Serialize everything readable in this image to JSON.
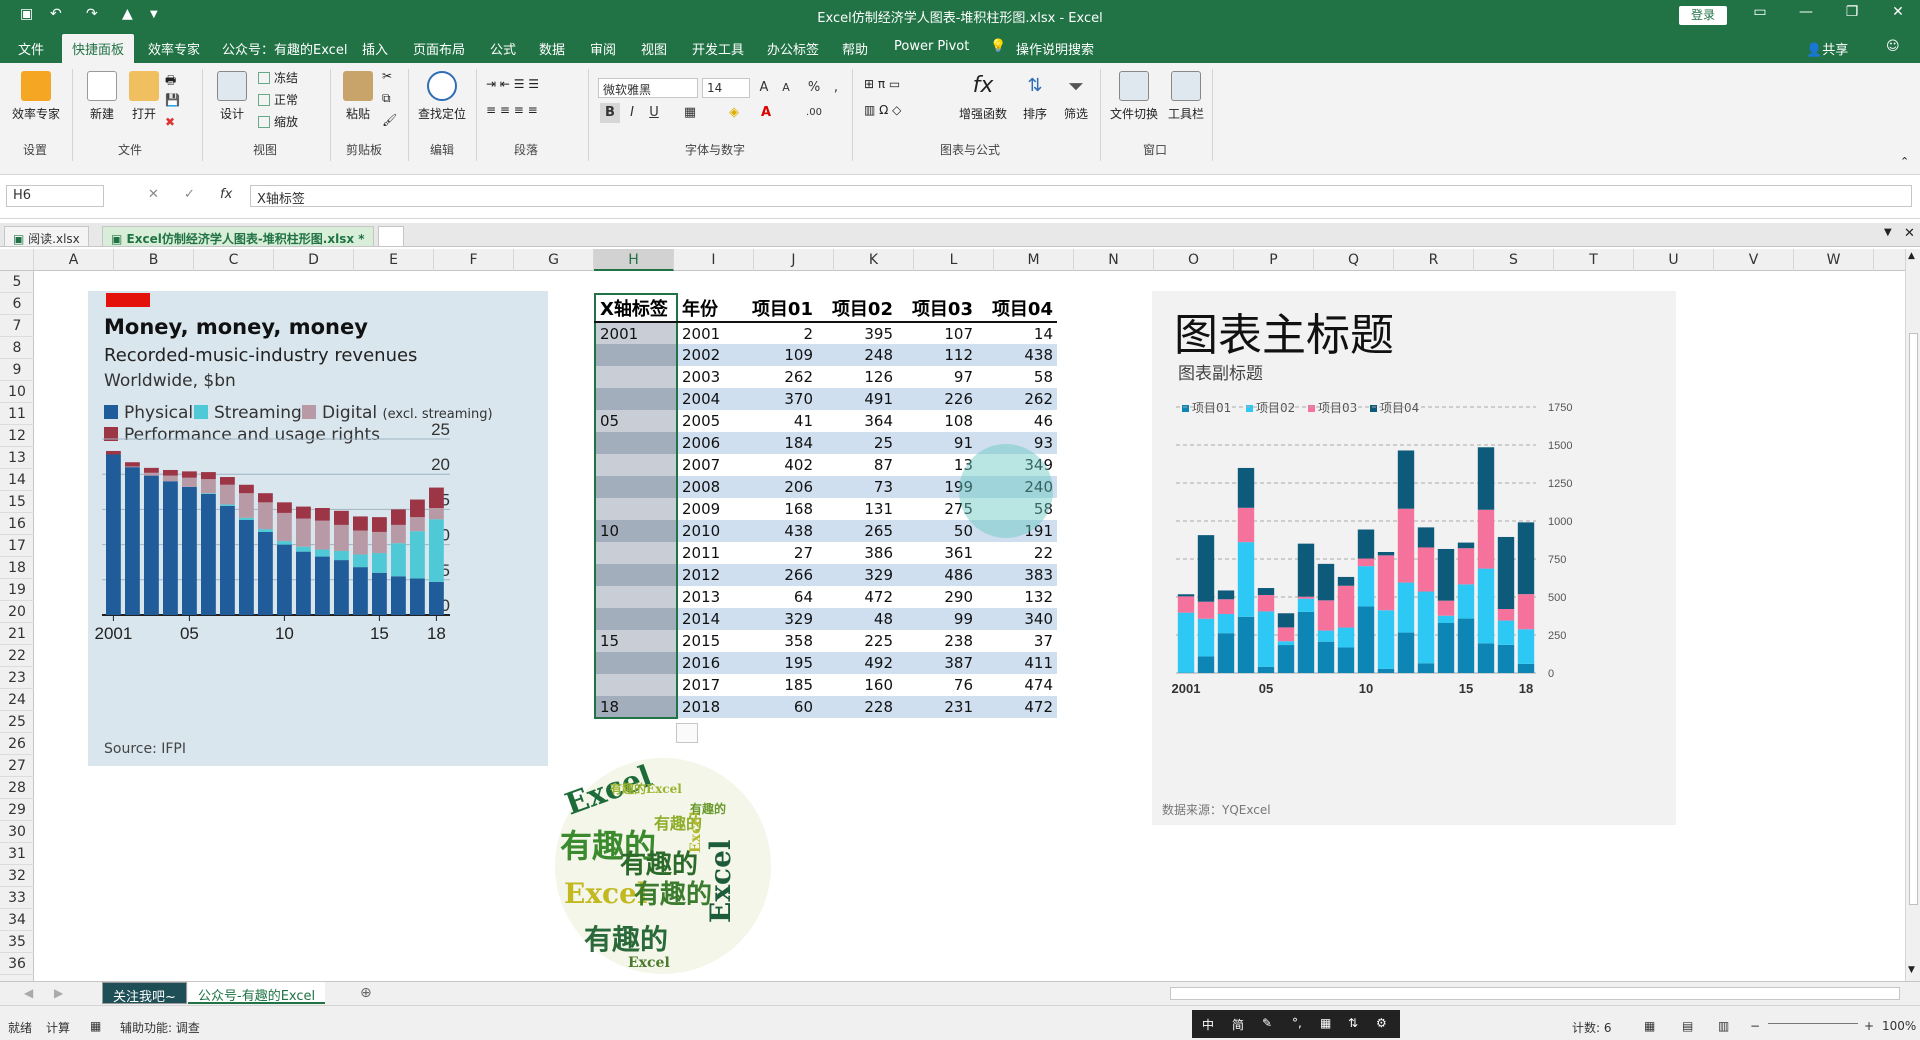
{
  "app": {
    "title": "Excel仿制经济学人图表-堆积柱形图.xlsx  -  Excel",
    "login_label": "登录"
  },
  "ribbon_tabs": [
    "文件",
    "快捷面板",
    "效率专家",
    "公众号：有趣的Excel",
    "插入",
    "页面布局",
    "公式",
    "数据",
    "审阅",
    "视图",
    "开发工具",
    "办公标签",
    "帮助",
    "Power Pivot",
    "操作说明搜索"
  ],
  "share_label": "共享",
  "ribbon": {
    "settings_group": {
      "button": "效率专家",
      "label": "设置"
    },
    "file_group": {
      "new": "新建",
      "open": "打开",
      "label": "文件"
    },
    "view_group": {
      "design": "设计",
      "freeze": "冻结",
      "normal": "正常",
      "zoom": "缩放",
      "label": "视图"
    },
    "clipboard_group": {
      "paste": "粘贴",
      "label": "剪贴板"
    },
    "edit_group": {
      "find": "查找定位",
      "label": "编辑"
    },
    "para_group": {
      "label": "段落"
    },
    "font_group": {
      "font_name": "微软雅黑",
      "font_size": "14",
      "bold": "B",
      "italic": "I",
      "underline": "U",
      "percent": "%",
      "comma": ",",
      "label": "字体与数字"
    },
    "chart_group": {
      "func": "增强函数",
      "sort": "排序",
      "filter": "筛选",
      "label": "图表与公式"
    },
    "window_group": {
      "switch": "文件切换",
      "toolbar": "工具栏",
      "label": "窗口"
    }
  },
  "formula_bar": {
    "name_box": "H6",
    "formula": "X轴标签",
    "fx": "fx"
  },
  "doc_tabs": [
    "阅读.xlsx",
    "Excel仿制经济学人图表-堆积柱形图.xlsx *"
  ],
  "columns": [
    "A",
    "B",
    "C",
    "D",
    "E",
    "F",
    "G",
    "H",
    "I",
    "J",
    "K",
    "L",
    "M",
    "N",
    "O",
    "P",
    "Q",
    "R",
    "S",
    "T",
    "U",
    "V",
    "W"
  ],
  "rows": [
    "5",
    "6",
    "7",
    "8",
    "9",
    "10",
    "11",
    "12",
    "13",
    "14",
    "15",
    "16",
    "17",
    "18",
    "19",
    "20",
    "21",
    "22",
    "23",
    "24",
    "25",
    "26",
    "27",
    "28",
    "29",
    "30",
    "31",
    "32",
    "33",
    "34",
    "35",
    "36"
  ],
  "economist_chart": {
    "title": "Money, money, money",
    "subtitle": "Recorded-music-industry revenues",
    "unit": "Worldwide, $bn",
    "legend": [
      {
        "name": "Physical",
        "color": "#1f5c99"
      },
      {
        "name": "Streaming",
        "color": "#4fc9d6"
      },
      {
        "name": "Digital",
        "note": "(excl. streaming)",
        "color": "#b89aa6"
      },
      {
        "name": "Performance and usage rights",
        "color": "#9c3546"
      }
    ],
    "x_tick_labels": [
      "2001",
      "05",
      "10",
      "15",
      "18"
    ],
    "y_tick_labels": [
      "25",
      "20",
      "15",
      "10",
      "5",
      "0"
    ],
    "source": "Source: IFPI"
  },
  "table": {
    "headers": [
      "X轴标签",
      "年份",
      "项目01",
      "项目02",
      "项目03",
      "项目04"
    ],
    "rows": [
      [
        "2001",
        "2001",
        "2",
        "395",
        "107",
        "14"
      ],
      [
        "",
        "2002",
        "109",
        "248",
        "112",
        "438"
      ],
      [
        "",
        "2003",
        "262",
        "126",
        "97",
        "58"
      ],
      [
        "",
        "2004",
        "370",
        "491",
        "226",
        "262"
      ],
      [
        "05",
        "2005",
        "41",
        "364",
        "108",
        "46"
      ],
      [
        "",
        "2006",
        "184",
        "25",
        "91",
        "93"
      ],
      [
        "",
        "2007",
        "402",
        "87",
        "13",
        "349"
      ],
      [
        "",
        "2008",
        "206",
        "73",
        "199",
        "240"
      ],
      [
        "",
        "2009",
        "168",
        "131",
        "275",
        "58"
      ],
      [
        "10",
        "2010",
        "438",
        "265",
        "50",
        "191"
      ],
      [
        "",
        "2011",
        "27",
        "386",
        "361",
        "22"
      ],
      [
        "",
        "2012",
        "266",
        "329",
        "486",
        "383"
      ],
      [
        "",
        "2013",
        "64",
        "472",
        "290",
        "132"
      ],
      [
        "",
        "2014",
        "329",
        "48",
        "99",
        "340"
      ],
      [
        "15",
        "2015",
        "358",
        "225",
        "238",
        "37"
      ],
      [
        "",
        "2016",
        "195",
        "492",
        "387",
        "411"
      ],
      [
        "",
        "2017",
        "185",
        "160",
        "76",
        "474"
      ],
      [
        "18",
        "2018",
        "60",
        "228",
        "231",
        "472"
      ]
    ]
  },
  "right_chart": {
    "title": "图表主标题",
    "subtitle": "图表副标题",
    "source": "数据来源：YQExcel",
    "legend": [
      {
        "name": "项目01",
        "color": "#0e86b5"
      },
      {
        "name": "项目02",
        "color": "#2ec8f5"
      },
      {
        "name": "项目03",
        "color": "#f4729c"
      },
      {
        "name": "项目04",
        "color": "#0d5a7a"
      }
    ],
    "y_tick_labels": [
      "1750",
      "1500",
      "1250",
      "1000",
      "750",
      "500",
      "250",
      "0"
    ],
    "x_tick_labels": [
      "2001",
      "05",
      "10",
      "15",
      "18"
    ]
  },
  "sheet_tabs": [
    "关注我吧~",
    "公众号-有趣的Excel"
  ],
  "status": {
    "ready": "就绪",
    "calc": "计算",
    "accessibility": "辅助功能: 调查",
    "count": "计数: 6",
    "zoom": "100%"
  },
  "ime": [
    "中",
    "简"
  ],
  "chart_data": [
    {
      "type": "bar",
      "stacked": true,
      "categories": [
        "2001",
        "2002",
        "2003",
        "2004",
        "2005",
        "2006",
        "2007",
        "2008",
        "2009",
        "2010",
        "2011",
        "2012",
        "2013",
        "2014",
        "2015",
        "2016",
        "2017",
        "2018"
      ],
      "series": [
        {
          "name": "Physical",
          "values": [
            22.8,
            21.0,
            19.8,
            19.0,
            18.2,
            17.2,
            15.5,
            13.5,
            11.8,
            10.0,
            9.0,
            8.3,
            7.8,
            6.8,
            6.0,
            5.5,
            5.2,
            4.7
          ]
        },
        {
          "name": "Streaming",
          "values": [
            0,
            0,
            0,
            0,
            0,
            0.1,
            0.2,
            0.3,
            0.4,
            0.5,
            0.7,
            1.0,
            1.3,
            1.8,
            2.8,
            4.7,
            6.7,
            8.9
          ]
        },
        {
          "name": "Digital (excl. streaming)",
          "values": [
            0,
            0.1,
            0.4,
            0.8,
            1.3,
            2.0,
            2.8,
            3.5,
            3.8,
            4.0,
            4.0,
            4.1,
            3.7,
            3.4,
            3.0,
            2.6,
            2.0,
            1.6
          ]
        },
        {
          "name": "Performance and usage rights",
          "values": [
            0.5,
            0.6,
            0.7,
            0.8,
            0.9,
            1.0,
            1.1,
            1.2,
            1.3,
            1.5,
            1.7,
            1.8,
            2.0,
            2.0,
            2.1,
            2.2,
            2.5,
            2.9
          ]
        }
      ],
      "ylim": [
        0,
        25
      ]
    },
    {
      "type": "bar",
      "stacked": true,
      "categories": [
        "2001",
        "2002",
        "2003",
        "2004",
        "2005",
        "2006",
        "2007",
        "2008",
        "2009",
        "2010",
        "2011",
        "2012",
        "2013",
        "2014",
        "2015",
        "2016",
        "2017",
        "2018"
      ],
      "series": [
        {
          "name": "项目01",
          "values": [
            2,
            109,
            262,
            370,
            41,
            184,
            402,
            206,
            168,
            438,
            27,
            266,
            64,
            329,
            358,
            195,
            185,
            60
          ]
        },
        {
          "name": "项目02",
          "values": [
            395,
            248,
            126,
            491,
            364,
            25,
            87,
            73,
            131,
            265,
            386,
            329,
            472,
            48,
            225,
            492,
            160,
            228
          ]
        },
        {
          "name": "项目03",
          "values": [
            107,
            112,
            97,
            226,
            108,
            91,
            13,
            199,
            275,
            50,
            361,
            486,
            290,
            99,
            238,
            387,
            76,
            231
          ]
        },
        {
          "name": "项目04",
          "values": [
            14,
            438,
            58,
            262,
            46,
            93,
            349,
            240,
            58,
            191,
            22,
            383,
            132,
            340,
            37,
            411,
            474,
            472
          ]
        }
      ],
      "title": "图表主标题",
      "subtitle": "图表副标题",
      "ylim": [
        0,
        1750
      ]
    }
  ]
}
